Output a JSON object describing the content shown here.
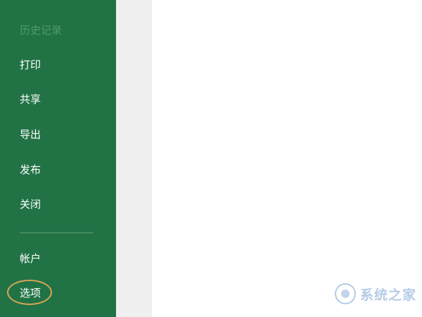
{
  "sidebar": {
    "top_partial": "",
    "items": [
      {
        "label": "历史记录",
        "state": "disabled"
      },
      {
        "label": "打印",
        "state": "normal"
      },
      {
        "label": "共享",
        "state": "normal"
      },
      {
        "label": "导出",
        "state": "normal"
      },
      {
        "label": "发布",
        "state": "normal"
      },
      {
        "label": "关闭",
        "state": "normal"
      }
    ],
    "bottom_items": [
      {
        "label": "帐户",
        "state": "normal"
      },
      {
        "label": "选项",
        "state": "highlighted"
      }
    ]
  },
  "watermark": {
    "text": "系统之家"
  },
  "colors": {
    "sidebar_bg": "#217346",
    "highlight_ring": "#d6a752",
    "content_bg": "#ffffff",
    "strip_bg": "#f0f0f0"
  }
}
